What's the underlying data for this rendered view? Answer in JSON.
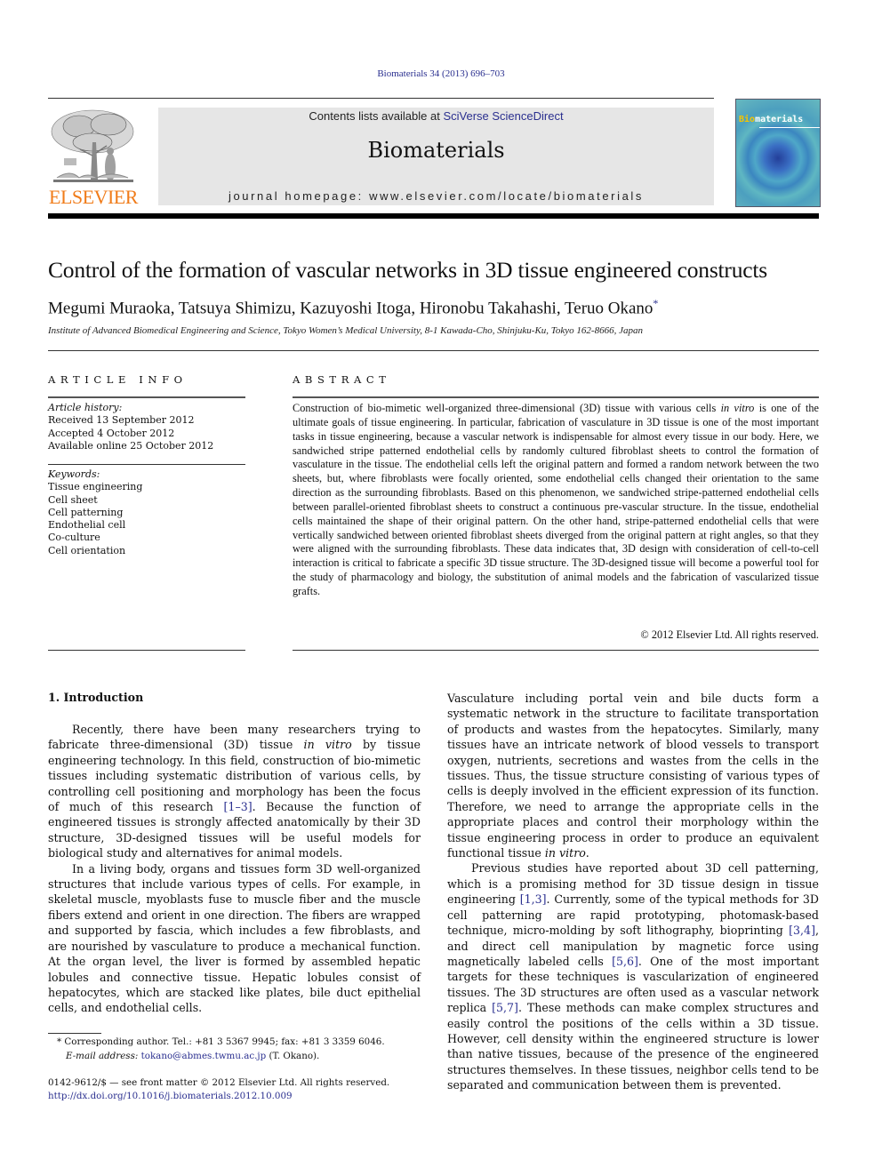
{
  "header": {
    "citation": "Biomaterials 34 (2013) 696–703",
    "publisher_logo_text": "ELSEVIER",
    "contents_prefix": "Contents lists available at ",
    "contents_link": "SciVerse ScienceDirect",
    "journal_name": "Biomaterials",
    "homepage": "journal homepage: www.elsevier.com/locate/biomaterials",
    "cover_title_highlight": "Bio",
    "cover_title_rest": "materials"
  },
  "article": {
    "title": "Control of the formation of vascular networks in 3D tissue engineered constructs",
    "authors": "Megumi Muraoka, Tatsuya Shimizu, Kazuyoshi Itoga, Hironobu Takahashi, Teruo Okano",
    "corresponding_mark": "*",
    "affiliation": "Institute of Advanced Biomedical Engineering and Science, Tokyo Women’s Medical University, 8-1 Kawada-Cho, Shinjuku-Ku, Tokyo 162-8666, Japan"
  },
  "article_info": {
    "heading": "ARTICLE INFO",
    "history_label": "Article history:",
    "history": [
      "Received 13 September 2012",
      "Accepted 4 October 2012",
      "Available online 25 October 2012"
    ],
    "keywords_label": "Keywords:",
    "keywords": [
      "Tissue engineering",
      "Cell sheet",
      "Cell patterning",
      "Endothelial cell",
      "Co-culture",
      "Cell orientation"
    ]
  },
  "abstract": {
    "heading": "ABSTRACT",
    "p1_a": "Construction of bio-mimetic well-organized three-dimensional (3D) tissue with various cells ",
    "p1_italic": "in vitro",
    "p1_b": " is one of the ultimate goals of tissue engineering. In particular, fabrication of vasculature in 3D tissue is one of the most important tasks in tissue engineering, because a vascular network is indispensable for almost every tissue in our body. Here, we sandwiched stripe patterned endothelial cells by randomly cultured fibroblast sheets to control the formation of vasculature in the tissue. The endothelial cells left the original pattern and formed a random network between the two sheets, but, where fibroblasts were focally oriented, some endothelial cells changed their orientation to the same direction as the surrounding fibroblasts. Based on this phenomenon, we sandwiched stripe-patterned endothelial cells between parallel-oriented fibroblast sheets to construct a continuous pre-vascular structure. In the tissue, endothelial cells maintained the shape of their original pattern. On the other hand, stripe-patterned endothelial cells that were vertically sandwiched between oriented fibroblast sheets diverged from the original pattern at right angles, so that they were aligned with the surrounding fibroblasts. These data indicates that, 3D design with consideration of cell-to-cell interaction is critical to fabricate a specific 3D tissue structure. The 3D-designed tissue will become a powerful tool for the study of pharmacology and biology, the substitution of animal models and the fabrication of vascularized tissue grafts.",
    "copyright": "© 2012 Elsevier Ltd. All rights reserved."
  },
  "introduction": {
    "heading": "1.  Introduction",
    "p1_a": "Recently, there have been many researchers trying to fabricate three-dimensional (3D) tissue ",
    "p1_italic": "in vitro",
    "p1_b": " by tissue engineering technology. In this field, construction of bio-mimetic tissues including systematic distribution of various cells, by controlling cell positioning and morphology has been the focus of much of this research ",
    "p1_ref": "[1–3]",
    "p1_c": ". Because the function of engineered tissues is strongly affected anatomically by their 3D structure, 3D-designed tissues will be useful models for biological study and alternatives for animal models.",
    "p2": "In a living body, organs and tissues form 3D well-organized structures that include various types of cells. For example, in skeletal muscle, myoblasts fuse to muscle fiber and the muscle fibers extend and orient in one direction. The fibers are wrapped and supported by fascia, which includes a few fibroblasts, and are nourished by vasculature to produce a mechanical function. At the organ level, the liver is formed by assembled hepatic lobules and connective tissue. Hepatic lobules consist of hepatocytes, which are stacked like plates, bile duct epithelial cells, and endothelial cells.",
    "p2_cont_a": "Vasculature including portal vein and bile ducts form a systematic network in the structure to facilitate transportation of products and wastes from the hepatocytes. Similarly, many tissues have an intricate network of blood vessels to transport oxygen, nutrients, secretions and wastes from the cells in the tissues. Thus, the tissue structure consisting of various types of cells is deeply involved in the efficient expression of its function. Therefore, we need to arrange the appropriate cells in the appropriate places and control their morphology within the tissue engineering process in order to produce an equivalent functional tissue ",
    "p2_cont_italic": "in vitro",
    "p2_cont_b": ".",
    "p3_a": "Previous studies have reported about 3D cell patterning, which is a promising method for 3D tissue design in tissue engineering ",
    "p3_ref1": "[1,3]",
    "p3_b": ". Currently, some of the typical methods for 3D cell patterning are rapid prototyping, photomask-based technique, micro-molding by soft lithography, bioprinting ",
    "p3_ref2": "[3,4]",
    "p3_c": ", and direct cell manipulation by magnetic force using magnetically labeled cells ",
    "p3_ref3": "[5,6]",
    "p3_d": ". One of the most important targets for these techniques is vascularization of engineered tissues. The 3D structures are often used as a vascular network replica ",
    "p3_ref4": "[5,7]",
    "p3_e": ". These methods can make complex structures and easily control the positions of the cells within a 3D tissue. However, cell density within the engineered structure is lower than native tissues, because of the presence of the engineered structures themselves. In these tissues, neighbor cells tend to be separated and communication between them is prevented."
  },
  "footnote": {
    "mark": "*",
    "corresponding": " Corresponding author. Tel.: +81 3 5367 9945; fax: +81 3 3359 6046.",
    "email_label": "E-mail address:",
    "email": "tokano@abmes.twmu.ac.jp",
    "email_suffix": " (T. Okano)."
  },
  "front_matter": {
    "issn_line": "0142-9612/$ — see front matter © 2012 Elsevier Ltd. All rights reserved.",
    "doi": "http://dx.doi.org/10.1016/j.biomaterials.2012.10.009"
  }
}
